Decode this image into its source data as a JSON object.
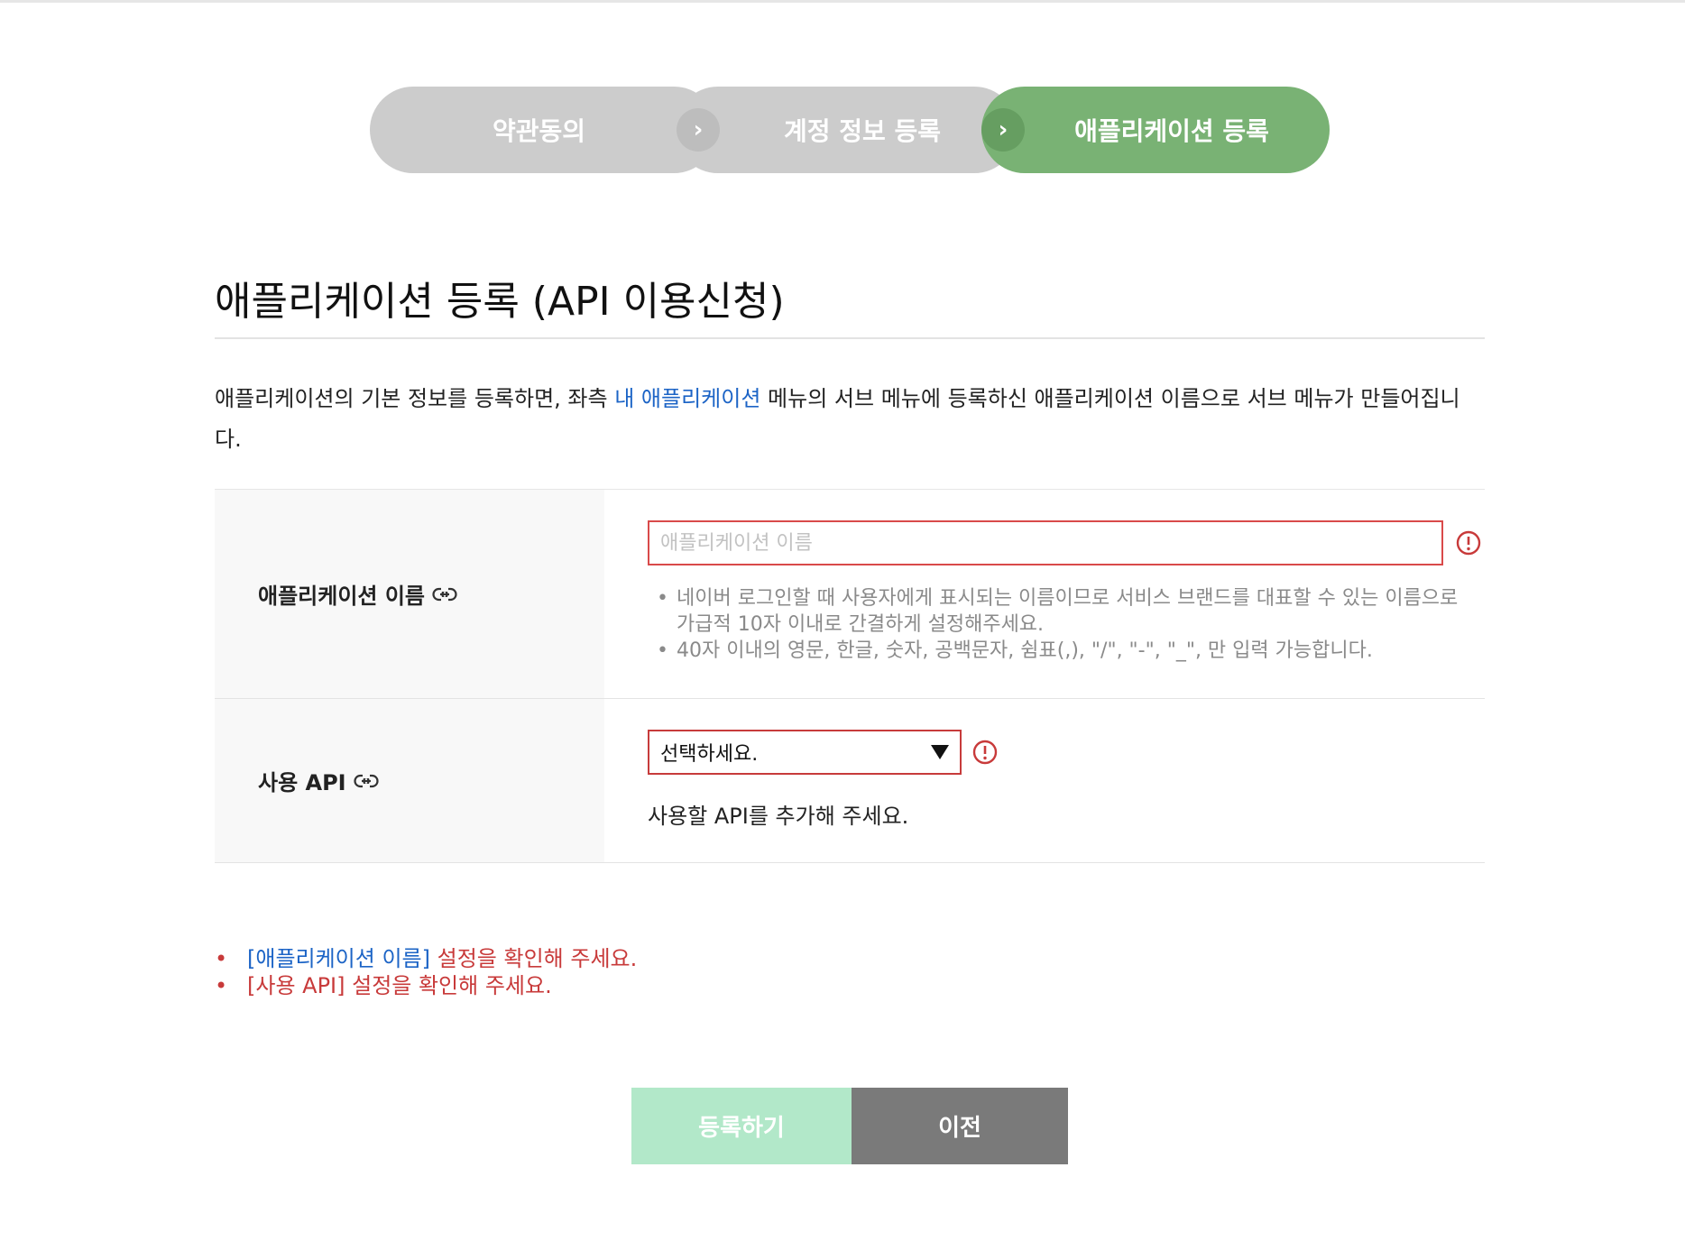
{
  "steps": [
    {
      "label": "약관동의",
      "state": "done"
    },
    {
      "label": "계정 정보 등록",
      "state": "done"
    },
    {
      "label": "애플리케이션 등록",
      "state": "active"
    }
  ],
  "page": {
    "title": "애플리케이션 등록 (API 이용신청)",
    "description_before": "애플리케이션의 기본 정보를 등록하면, 좌측 ",
    "description_link": "내 애플리케이션",
    "description_after": " 메뉴의 서브 메뉴에 등록하신 애플리케이션 이름으로 서브 메뉴가 만들어집니다."
  },
  "form": {
    "app_name": {
      "label": "애플리케이션 이름",
      "placeholder": "애플리케이션 이름",
      "value": "",
      "help": [
        "네이버 로그인할 때 사용자에게 표시되는 이름이므로 서비스 브랜드를 대표할 수 있는 이름으로 가급적 10자 이내로 간결하게 설정해주세요.",
        "40자 이내의 영문, 한글, 숫자, 공백문자, 쉼표(,), \"/\", \"-\", \"_\", 만 입력 가능합니다."
      ]
    },
    "api": {
      "label": "사용 API",
      "selected": "선택하세요.",
      "help": "사용할 API를 추가해 주세요."
    }
  },
  "errors": [
    {
      "field": "[애플리케이션 이름]",
      "message": " 설정을 확인해 주세요."
    },
    {
      "field": "[사용 API]",
      "message": " 설정을 확인해 주세요."
    }
  ],
  "buttons": {
    "register": "등록하기",
    "previous": "이전"
  },
  "icons": {
    "step_arrow": "chevron-right-icon",
    "field_link": "link-icon",
    "field_warning": "exclamation-circle-icon",
    "select_arrow": "triangle-down-icon"
  },
  "colors": {
    "step_done": "#cccccc",
    "step_active": "#79b274",
    "error": "#c83a3a",
    "link": "#1c64c6",
    "register_button": "#b2e8c9",
    "previous_button": "#7a7a7a"
  }
}
